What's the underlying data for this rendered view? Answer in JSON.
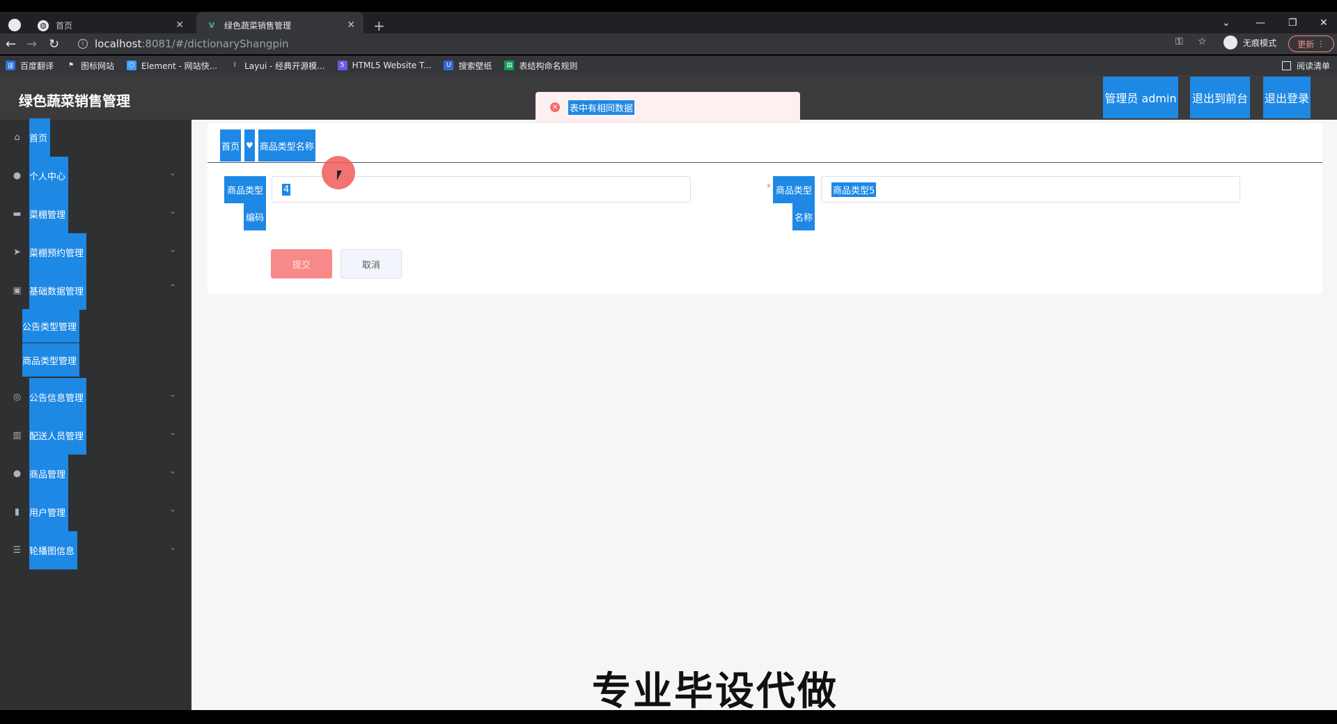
{
  "browser": {
    "tabs": [
      {
        "label": "首页",
        "active": false
      },
      {
        "label": "绿色蔬菜销售管理",
        "active": true
      }
    ],
    "url_host": "localhost",
    "url_rest": ":8081/#/dictionaryShangpin",
    "incognito_label": "无痕模式",
    "update_label": "更新",
    "bookmarks": [
      {
        "label": "百度翻译",
        "icon": "baidu-translate-icon",
        "color": "#2f6fdb"
      },
      {
        "label": "图标网站",
        "icon": "flag-icon",
        "color": "#444"
      },
      {
        "label": "Element - 网站快...",
        "icon": "element-icon",
        "color": "#409eff"
      },
      {
        "label": "Layui - 经典开源模...",
        "icon": "layui-icon",
        "color": "#555"
      },
      {
        "label": "HTML5 Website T...",
        "icon": "html5-icon",
        "color": "#6b5be5"
      },
      {
        "label": "搜索壁纸",
        "icon": "wallpaper-icon",
        "color": "#3a66d6"
      },
      {
        "label": "表结构命名规则",
        "icon": "doc-icon",
        "color": "#0f9d58"
      }
    ],
    "reading_list_label": "阅读清单"
  },
  "app": {
    "title": "绿色蔬菜销售管理",
    "header_buttons": [
      "管理员 admin",
      "退出到前台",
      "退出登录"
    ],
    "menu": [
      {
        "label": "首页",
        "icon": "home-icon",
        "expandable": false
      },
      {
        "label": "个人中心",
        "icon": "user-icon",
        "expandable": true
      },
      {
        "label": "菜棚管理",
        "icon": "chat-icon",
        "expandable": true
      },
      {
        "label": "菜棚预约管理",
        "icon": "send-icon",
        "expandable": true
      },
      {
        "label": "基础数据管理",
        "icon": "clipboard-icon",
        "expandable": true,
        "expanded": true
      },
      {
        "label": "公告信息管理",
        "icon": "globe-icon",
        "expandable": true
      },
      {
        "label": "配送人员管理",
        "icon": "bar-chart-icon",
        "expandable": true
      },
      {
        "label": "商品管理",
        "icon": "pin-icon",
        "expandable": true
      },
      {
        "label": "用户管理",
        "icon": "books-icon",
        "expandable": true
      },
      {
        "label": "轮播图信息",
        "icon": "sliders-icon",
        "expandable": true
      }
    ],
    "submenu": [
      "公告类型管理",
      "商品类型管理"
    ],
    "breadcrumb": [
      "首页",
      "商品类型名称"
    ],
    "form": {
      "code_label_1": "商品类型",
      "code_label_2": "编码",
      "code_value": "4",
      "name_label_1": "商品类型",
      "name_label_2": "名称",
      "name_value": "商品类型5",
      "required_mark": "*",
      "submit_label": "提交",
      "cancel_label": "取消"
    },
    "toast_message": "表中有相同数据",
    "watermark": "专业毕设代做"
  }
}
